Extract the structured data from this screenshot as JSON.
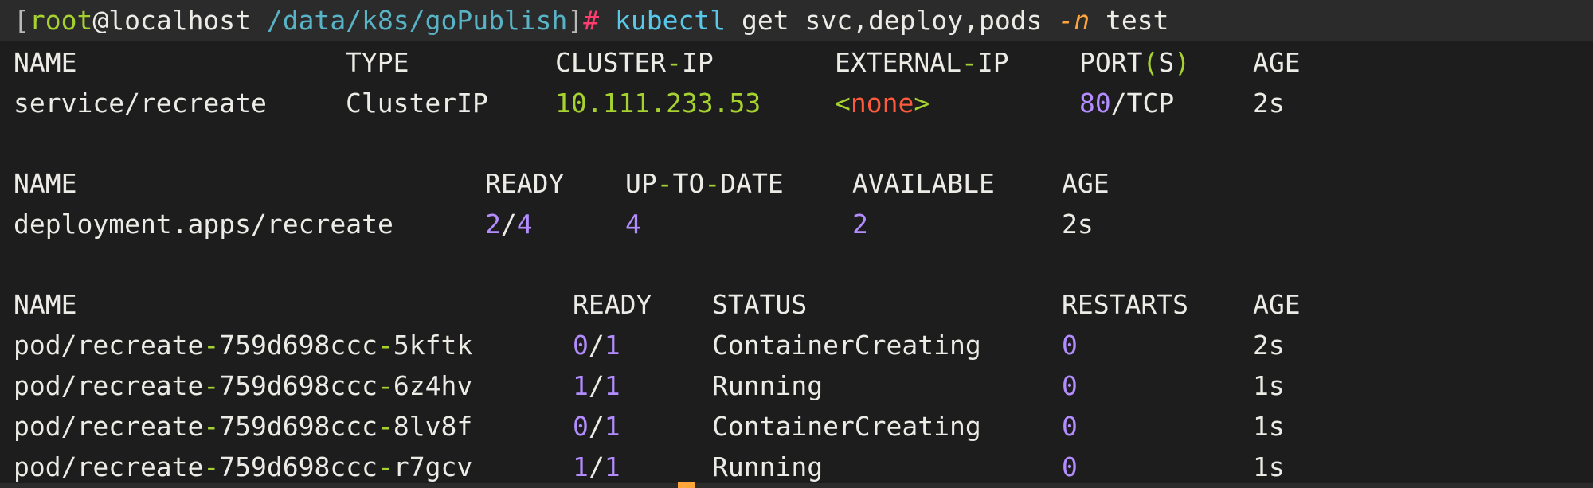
{
  "prompt": {
    "open_bracket": "[",
    "user": "root",
    "at_host": "@localhost",
    "space": " ",
    "path": "/data/k8s/goPublish",
    "close_bracket": "]",
    "hash": "#",
    "command": "kubectl",
    "args": "get svc,deploy,pods",
    "flag": "-n",
    "namespace": "test"
  },
  "service_table": {
    "headers": {
      "name": "NAME",
      "type": "TYPE",
      "cluster_ip_a": "CLUSTER",
      "cluster_ip_dash": "-",
      "cluster_ip_b": "IP",
      "external_ip_a": "EXTERNAL",
      "external_ip_dash": "-",
      "external_ip_b": "IP",
      "ports_a": "PORT",
      "ports_open": "(",
      "ports_s": "S",
      "ports_close": ")",
      "age": "AGE"
    },
    "rows": [
      {
        "name": "service/recreate",
        "type": "ClusterIP",
        "cluster_ip": "10.111.233.53",
        "external_lt": "<",
        "external_none": "none",
        "external_gt": ">",
        "port_num": "80",
        "port_proto": "/TCP",
        "age": "2s"
      }
    ]
  },
  "deployment_table": {
    "headers": {
      "name": "NAME",
      "ready": "READY",
      "up_a": "UP",
      "up_dash1": "-",
      "up_b": "TO",
      "up_dash2": "-",
      "up_c": "DATE",
      "available": "AVAILABLE",
      "age": "AGE"
    },
    "rows": [
      {
        "name": "deployment.apps/recreate",
        "ready_a": "2",
        "ready_slash": "/",
        "ready_b": "4",
        "up_to_date": "4",
        "available": "2",
        "age": "2s"
      }
    ]
  },
  "pod_table": {
    "headers": {
      "name": "NAME",
      "ready": "READY",
      "status": "STATUS",
      "restarts": "RESTARTS",
      "age": "AGE"
    },
    "rows": [
      {
        "prefix": "pod/recreate",
        "dash1": "-",
        "hash": "759d698ccc",
        "dash2": "-",
        "suffix": "5kftk",
        "ready_a": "0",
        "ready_slash": "/",
        "ready_b": "1",
        "status": "ContainerCreating",
        "restarts": "0",
        "age": "2s"
      },
      {
        "prefix": "pod/recreate",
        "dash1": "-",
        "hash": "759d698ccc",
        "dash2": "-",
        "suffix": "6z4hv",
        "ready_a": "1",
        "ready_slash": "/",
        "ready_b": "1",
        "status": "Running",
        "restarts": "0",
        "age": "1s"
      },
      {
        "prefix": "pod/recreate",
        "dash1": "-",
        "hash": "759d698ccc",
        "dash2": "-",
        "suffix": "8lv8f",
        "ready_a": "0",
        "ready_slash": "/",
        "ready_b": "1",
        "status": "ContainerCreating",
        "restarts": "0",
        "age": "1s"
      },
      {
        "prefix": "pod/recreate",
        "dash1": "-",
        "hash": "759d698ccc",
        "dash2": "-",
        "suffix": "r7gcv",
        "ready_a": "1",
        "ready_slash": "/",
        "ready_b": "1",
        "status": "Running",
        "restarts": "0",
        "age": "1s"
      }
    ]
  },
  "colors": {
    "background": "#1d1d1d",
    "foreground": "#ecebe6",
    "green": "#a6d230",
    "cyan": "#58c7e8",
    "purple": "#b38cff",
    "orange": "#ffa53a",
    "red": "#ff5a3c",
    "pink": "#ff3d6e"
  }
}
